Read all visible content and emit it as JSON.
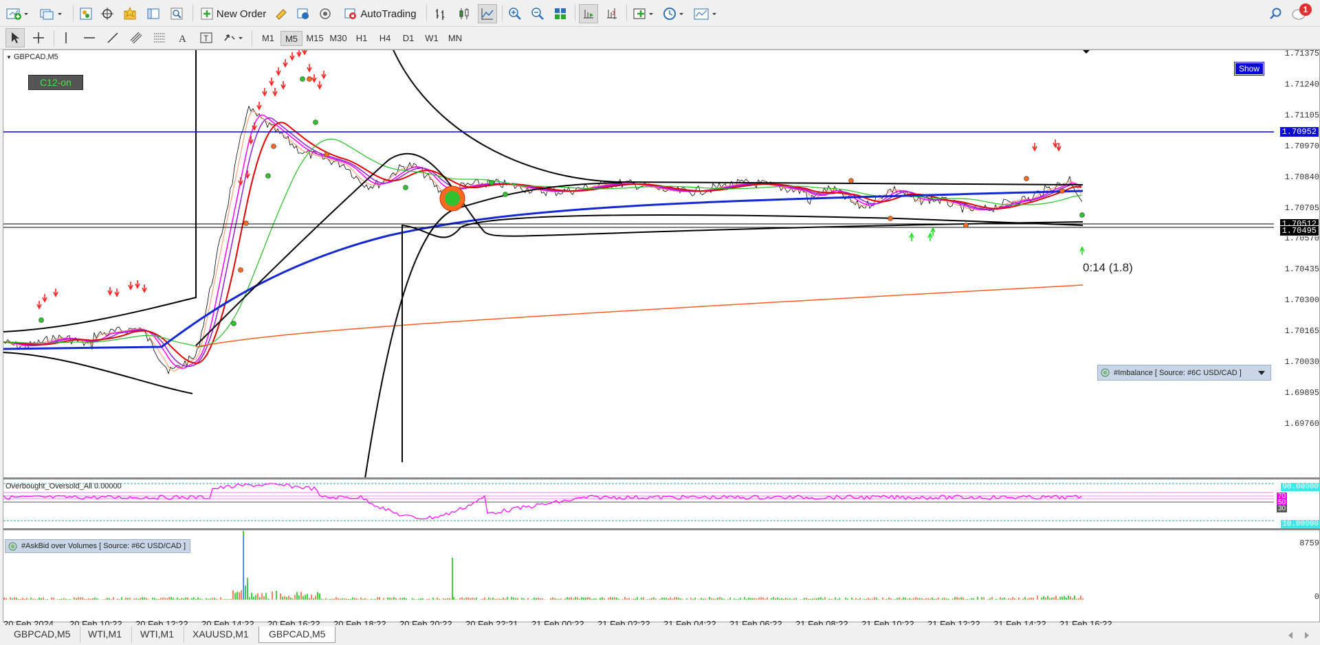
{
  "toolbar": {
    "new_order_label": "New Order",
    "autotrading_label": "AutoTrading",
    "notification_count": "1",
    "timeframes": [
      "M1",
      "M5",
      "M15",
      "M30",
      "H1",
      "H4",
      "D1",
      "W1",
      "MN"
    ],
    "active_timeframe": "M5"
  },
  "chart": {
    "symbol_label": "GBPCAD,M5",
    "c12_label": "C12-on",
    "show_button": "Show",
    "countdown_label": "0:14 (1.8)",
    "imbalance_label": "#Imbalance [ Source: #6C USD/CAD ]",
    "hline_price_label": "1.70952",
    "bid_price_label": "1.70512",
    "ask_price_label": "1.70495",
    "price_labels": [
      "1.71375",
      "1.71240",
      "1.71105",
      "1.70970",
      "1.70840",
      "1.70705",
      "1.70570",
      "1.70435",
      "1.70300",
      "1.70165",
      "1.70030",
      "1.69895",
      "1.69760"
    ],
    "colors": {
      "hline": "#0000ff",
      "ema_slow": "#1428d2",
      "ema_long": "#ff5a1e",
      "bollinger": "#000000",
      "oscillator": "#ff00ff"
    }
  },
  "oscillator": {
    "label": "Overbought_Oversold_All 0.00000",
    "upper_level": "90.00000",
    "lower_level": "10.00000",
    "mid_labels": [
      "70",
      "50",
      "30"
    ]
  },
  "volume": {
    "label": "#AskBid over Volumes [ Source: #6C USD/CAD ]",
    "max_label": "8759",
    "min_label": "0"
  },
  "time_axis": {
    "labels": [
      "20 Feb 2024",
      "20 Feb 10:22",
      "20 Feb 12:22",
      "20 Feb 14:22",
      "20 Feb 16:22",
      "20 Feb 18:22",
      "20 Feb 20:22",
      "20 Feb 22:21",
      "21 Feb 00:22",
      "21 Feb 02:22",
      "21 Feb 04:22",
      "21 Feb 06:22",
      "21 Feb 08:22",
      "21 Feb 10:22",
      "21 Feb 12:22",
      "21 Feb 14:22",
      "21 Feb 16:22"
    ]
  },
  "tabs": [
    "GBPCAD,M5",
    "WTI,M1",
    "WTI,M1",
    "XAUUSD,M1",
    "GBPCAD,M5"
  ],
  "active_tab": 4
}
